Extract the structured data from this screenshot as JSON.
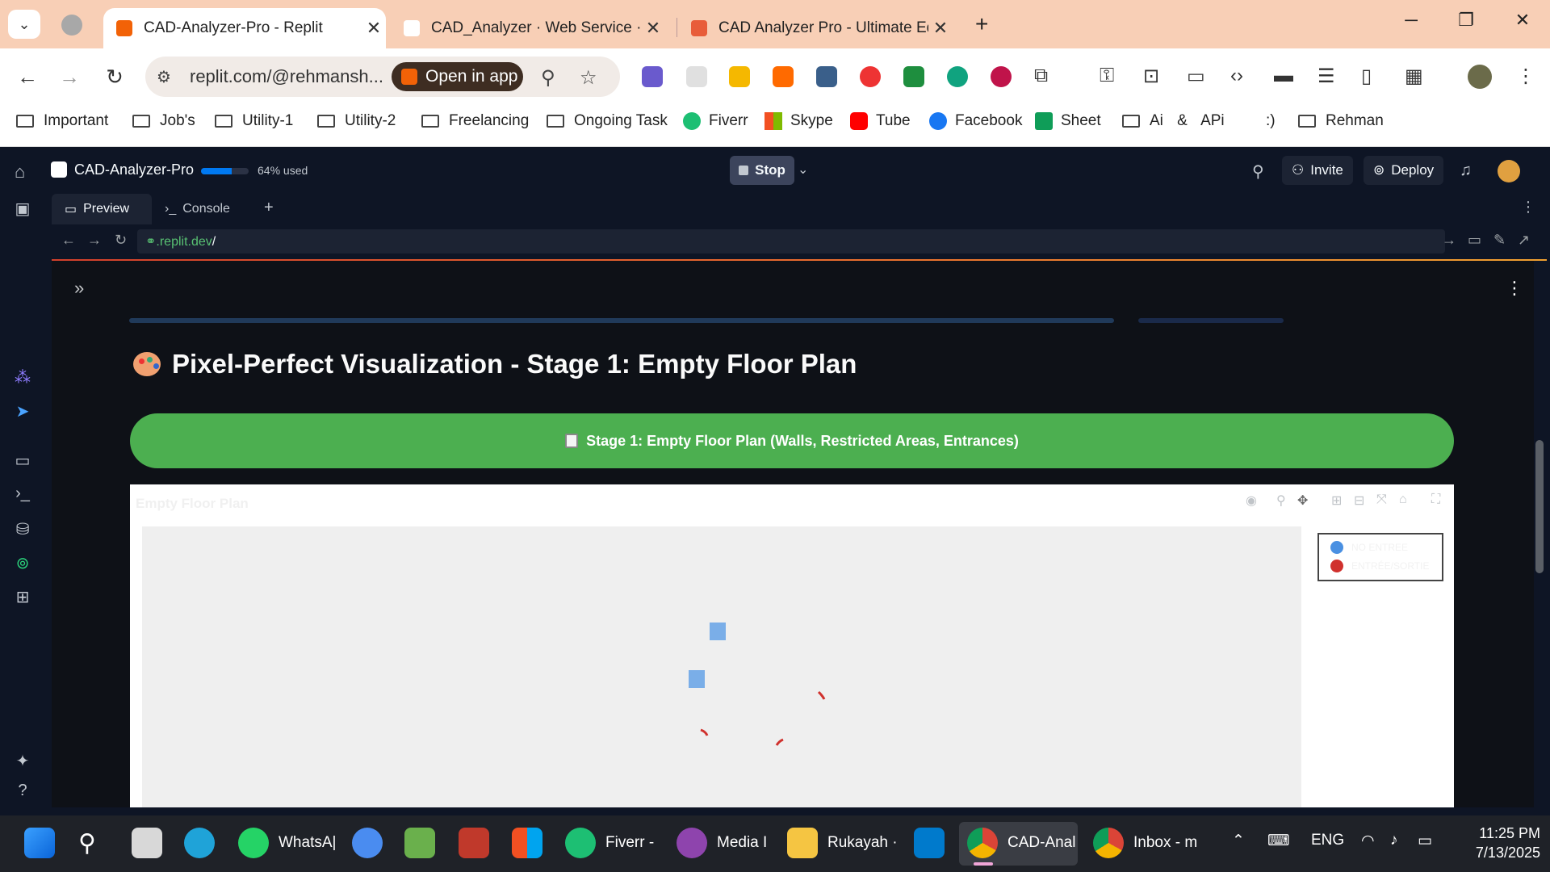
{
  "browser": {
    "tabs": [
      {
        "title": "CAD-Analyzer-Pro - Replit",
        "active": true
      },
      {
        "title": "CAD_Analyzer · Web Service · I",
        "active": false
      },
      {
        "title": "CAD Analyzer Pro - Ultimate Ed",
        "active": false
      }
    ],
    "url": "replit.com/@rehmansh...",
    "open_in_app": "Open in app",
    "bookmarks": [
      "Important",
      "Job's",
      "Utility-1",
      "Utility-2",
      "Freelancing",
      "Ongoing Task",
      "Fiverr",
      "Skype",
      "Tube",
      "Facebook",
      "Sheet",
      "Ai & APi",
      ":)",
      "Rehman"
    ]
  },
  "replit": {
    "project": "CAD-Analyzer-Pro",
    "usage_text": "64% used",
    "usage_fraction": 0.64,
    "stop": "Stop",
    "invite": "Invite",
    "deploy": "Deploy",
    "tab_preview": "Preview",
    "tab_console": "Console",
    "webview_url": ".replit.dev",
    "webview_url_slash": "/"
  },
  "app": {
    "title": "Pixel-Perfect Visualization - Stage 1: Empty Floor Plan",
    "stage_button": "Stage 1: Empty Floor Plan (Walls, Restricted Areas, Entrances)",
    "plot_title": "Empty Floor Plan",
    "legend": [
      {
        "label": "NO ENTREE",
        "color": "#4a90e2"
      },
      {
        "label": "ENTRÉE/SORTIE",
        "color": "#d0312d"
      }
    ]
  },
  "taskbar": {
    "apps": [
      "WhatsA|",
      "Fiverr -",
      "Media I",
      "Rukayah ·",
      "CAD-Anal",
      "Inbox - m"
    ],
    "lang": "ENG",
    "time": "11:25 PM",
    "date": "7/13/2025"
  }
}
